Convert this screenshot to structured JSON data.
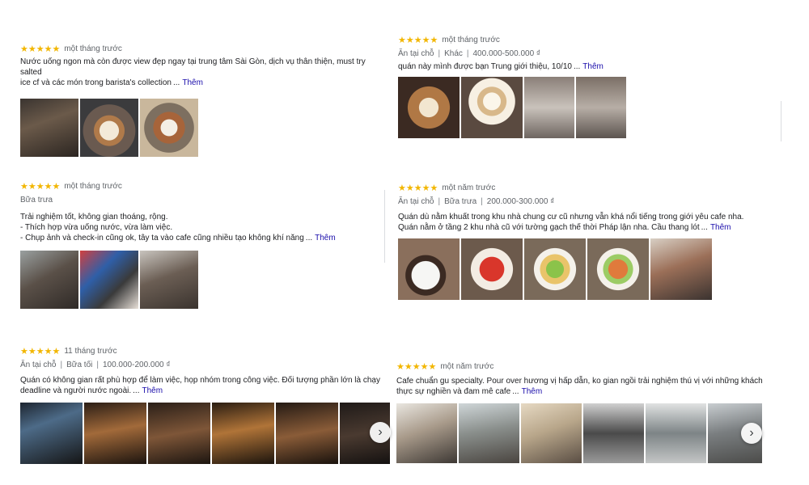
{
  "more_label": "Thêm",
  "ellipsis": "...",
  "star_glyphs": "★★★★★",
  "reviews": [
    {
      "rating": 5,
      "time": "một tháng trước",
      "text": "Nước uống ngon mà còn được view đẹp ngay tại trung tâm Sài Gòn, dịch vụ thân thiện, must try salted\nice cf và các món trong barista's collection"
    },
    {
      "rating": 5,
      "time": "một tháng trước",
      "meta": [
        "Ăn tại chỗ",
        "Khác",
        "400.000-500.000 ₫"
      ],
      "text": "quán này mình được bạn Trung giới thiệu, 10/10"
    },
    {
      "rating": 5,
      "time": "một tháng trước",
      "meta": [
        "Bữa trưa"
      ],
      "text": "Trải nghiệm tốt, không gian thoáng, rộng.\n- Thích hợp vừa uống nước, vừa làm việc.\n- Chụp ảnh và check-in cũng ok, tây ta vào cafe cũng nhiều tạo không khí năng"
    },
    {
      "rating": 5,
      "time": "một năm trước",
      "meta": [
        "Ăn tại chỗ",
        "Bữa trưa",
        "200.000-300.000 ₫"
      ],
      "text": "Quán dù nằm khuất trong khu nhà chung cư cũ nhưng vẫn khá nổi tiếng trong giới yêu cafe nha.\nQuán nằm ở tầng 2 khu nhà cũ với tường gạch thế thời Pháp lận nha. Cầu thang lót"
    },
    {
      "rating": 5,
      "time": "11 tháng trước",
      "meta": [
        "Ăn tại chỗ",
        "Bữa tối",
        "100.000-200.000 ₫"
      ],
      "text": "Quán có không gian rất phù hợp để làm việc, họp nhóm trong công việc. Đối tượng phần lớn là chạy\ndeadline và người nước ngoài."
    },
    {
      "rating": 5,
      "time": "một năm trước",
      "text": "Cafe chuẩn gu specialty. Pour over hương vị hấp dẫn, ko gian ngồi trải nghiệm thú vị với những khách\nthực sự nghiền và đam mê cafe"
    }
  ],
  "photo_names": {
    "r1": [
      "cafe-interior-photo",
      "iced-latte-photo",
      "iced-coffee-glass-photo"
    ],
    "r2": [
      "latte-art-photo",
      "affogato-photo",
      "person-at-wall-photo",
      "person-portrait-photo"
    ],
    "r3": [
      "cafe-workspace-photo",
      "painting-photo",
      "cafe-hall-photo"
    ],
    "r4": [
      "coffee-cup-photo",
      "pasta-photo",
      "salad-photo",
      "shrimp-salad-photo",
      "selfie-photo"
    ],
    "r5": [
      "dark-interior-photo-1",
      "dark-interior-photo-2",
      "bar-counter-photo",
      "pendant-lights-photo",
      "dining-hall-photo",
      "lounge-photo"
    ],
    "r6": [
      "bright-cafe-photo-1",
      "bright-cafe-photo-2",
      "menu-board-photo",
      "glass-door-photo",
      "window-wall-photo",
      "open-hall-photo",
      "seating-area-photo"
    ]
  }
}
